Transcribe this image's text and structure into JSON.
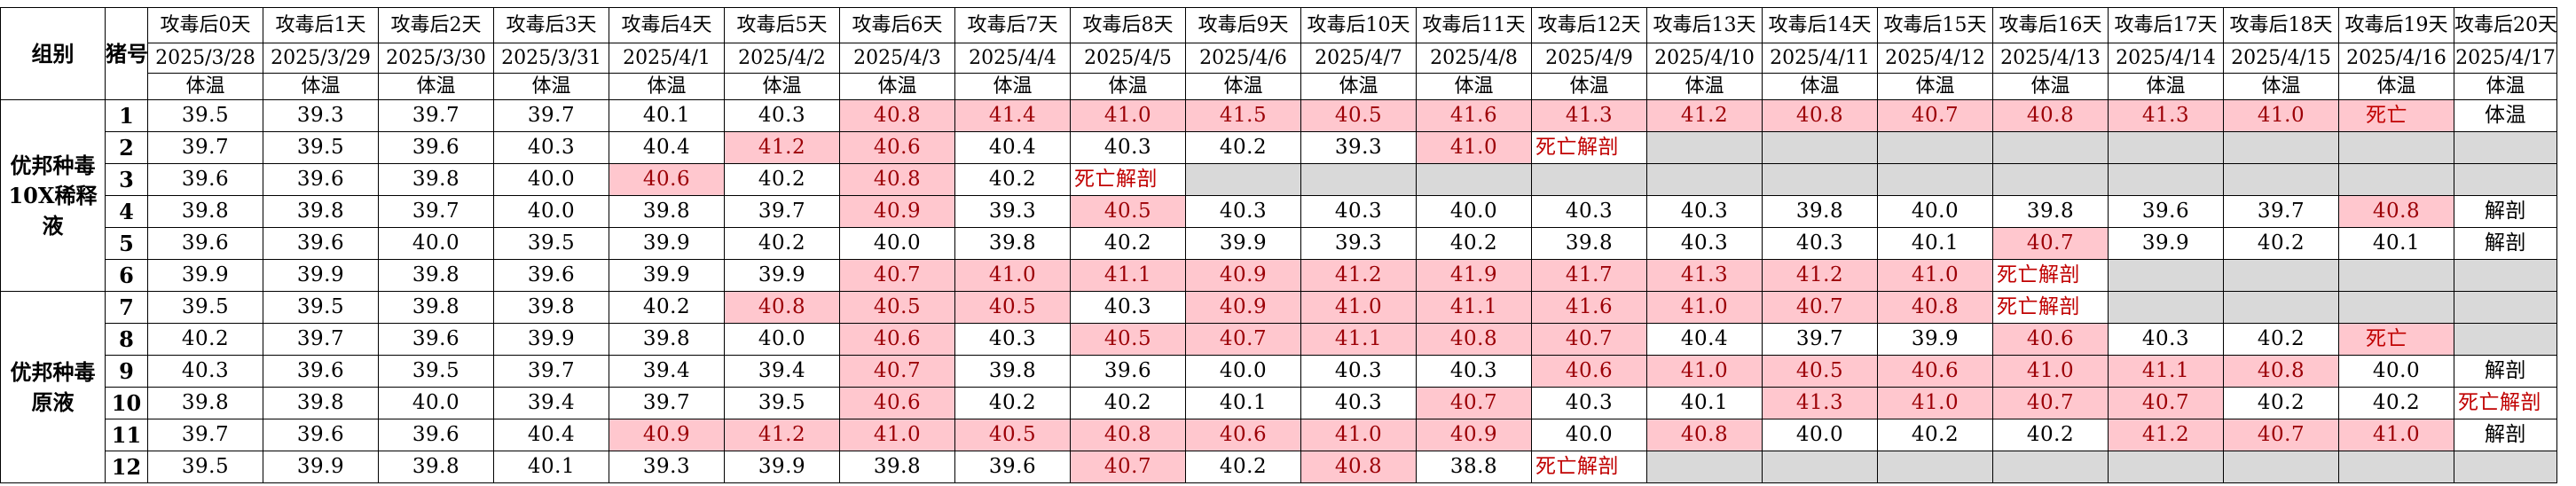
{
  "header": {
    "group_label": "组别",
    "pig_label": "猪号",
    "days": [
      "攻毒后0天",
      "攻毒后1天",
      "攻毒后2天",
      "攻毒后3天",
      "攻毒后4天",
      "攻毒后5天",
      "攻毒后6天",
      "攻毒后7天",
      "攻毒后8天",
      "攻毒后9天",
      "攻毒后10天",
      "攻毒后11天",
      "攻毒后12天",
      "攻毒后13天",
      "攻毒后14天",
      "攻毒后15天",
      "攻毒后16天",
      "攻毒后17天",
      "攻毒后18天",
      "攻毒后19天",
      "攻毒后20天"
    ],
    "dates": [
      "2025/3/28",
      "2025/3/29",
      "2025/3/30",
      "2025/3/31",
      "2025/4/1",
      "2025/4/2",
      "2025/4/3",
      "2025/4/4",
      "2025/4/5",
      "2025/4/6",
      "2025/4/7",
      "2025/4/8",
      "2025/4/9",
      "2025/4/10",
      "2025/4/11",
      "2025/4/12",
      "2025/4/13",
      "2025/4/14",
      "2025/4/15",
      "2025/4/16",
      "2025/4/17"
    ],
    "metric": "体温"
  },
  "groups": [
    {
      "name": "优邦种毒10X稀释液",
      "rows": [
        {
          "pig": "1",
          "cells": [
            {
              "v": "39.5"
            },
            {
              "v": "39.3"
            },
            {
              "v": "39.7"
            },
            {
              "v": "39.7"
            },
            {
              "v": "40.1"
            },
            {
              "v": "40.3"
            },
            {
              "v": "40.8",
              "s": "hot"
            },
            {
              "v": "41.4",
              "s": "hot"
            },
            {
              "v": "41.0",
              "s": "hot"
            },
            {
              "v": "41.5",
              "s": "hot"
            },
            {
              "v": "40.5",
              "s": "hot"
            },
            {
              "v": "41.6",
              "s": "hot"
            },
            {
              "v": "41.3",
              "s": "hot"
            },
            {
              "v": "41.2",
              "s": "hot"
            },
            {
              "v": "40.8",
              "s": "hot"
            },
            {
              "v": "40.7",
              "s": "hot"
            },
            {
              "v": "40.8",
              "s": "hot"
            },
            {
              "v": "41.3",
              "s": "hot"
            },
            {
              "v": "41.0",
              "s": "hot"
            },
            {
              "v": "死亡",
              "s": "hotdead"
            },
            {
              "v": "体温"
            }
          ]
        },
        {
          "pig": "2",
          "cells": [
            {
              "v": "39.7"
            },
            {
              "v": "39.5"
            },
            {
              "v": "39.6"
            },
            {
              "v": "40.3"
            },
            {
              "v": "40.4"
            },
            {
              "v": "41.2",
              "s": "hot"
            },
            {
              "v": "40.6",
              "s": "hot"
            },
            {
              "v": "40.4"
            },
            {
              "v": "40.3"
            },
            {
              "v": "40.2"
            },
            {
              "v": "39.3"
            },
            {
              "v": "41.0",
              "s": "hot"
            },
            {
              "v": "死亡解剖",
              "s": "dead"
            },
            {
              "v": "",
              "s": "gray"
            },
            {
              "v": "",
              "s": "gray"
            },
            {
              "v": "",
              "s": "gray"
            },
            {
              "v": "",
              "s": "gray"
            },
            {
              "v": "",
              "s": "gray"
            },
            {
              "v": "",
              "s": "gray"
            },
            {
              "v": "",
              "s": "gray"
            },
            {
              "v": "",
              "s": "gray"
            }
          ]
        },
        {
          "pig": "3",
          "cells": [
            {
              "v": "39.6"
            },
            {
              "v": "39.6"
            },
            {
              "v": "39.8"
            },
            {
              "v": "40.0"
            },
            {
              "v": "40.6",
              "s": "hot"
            },
            {
              "v": "40.2"
            },
            {
              "v": "40.8",
              "s": "hot"
            },
            {
              "v": "40.2"
            },
            {
              "v": "死亡解剖",
              "s": "dead"
            },
            {
              "v": "",
              "s": "gray"
            },
            {
              "v": "",
              "s": "gray"
            },
            {
              "v": "",
              "s": "gray"
            },
            {
              "v": "",
              "s": "gray"
            },
            {
              "v": "",
              "s": "gray"
            },
            {
              "v": "",
              "s": "gray"
            },
            {
              "v": "",
              "s": "gray"
            },
            {
              "v": "",
              "s": "gray"
            },
            {
              "v": "",
              "s": "gray"
            },
            {
              "v": "",
              "s": "gray"
            },
            {
              "v": "",
              "s": "gray"
            },
            {
              "v": "",
              "s": "gray"
            }
          ]
        },
        {
          "pig": "4",
          "cells": [
            {
              "v": "39.8"
            },
            {
              "v": "39.8"
            },
            {
              "v": "39.7"
            },
            {
              "v": "40.0"
            },
            {
              "v": "39.8"
            },
            {
              "v": "39.7"
            },
            {
              "v": "40.9",
              "s": "hot"
            },
            {
              "v": "39.3"
            },
            {
              "v": "40.5",
              "s": "hot"
            },
            {
              "v": "40.3"
            },
            {
              "v": "40.3"
            },
            {
              "v": "40.0"
            },
            {
              "v": "40.3"
            },
            {
              "v": "40.3"
            },
            {
              "v": "39.8"
            },
            {
              "v": "40.0"
            },
            {
              "v": "39.8"
            },
            {
              "v": "39.6"
            },
            {
              "v": "39.7"
            },
            {
              "v": "40.8",
              "s": "hot"
            },
            {
              "v": "解剖"
            }
          ]
        },
        {
          "pig": "5",
          "cells": [
            {
              "v": "39.6"
            },
            {
              "v": "39.6"
            },
            {
              "v": "40.0"
            },
            {
              "v": "39.5"
            },
            {
              "v": "39.9"
            },
            {
              "v": "40.2"
            },
            {
              "v": "40.0"
            },
            {
              "v": "39.8"
            },
            {
              "v": "40.2"
            },
            {
              "v": "39.9"
            },
            {
              "v": "39.3"
            },
            {
              "v": "40.2"
            },
            {
              "v": "39.8"
            },
            {
              "v": "40.3"
            },
            {
              "v": "40.3"
            },
            {
              "v": "40.1"
            },
            {
              "v": "40.7",
              "s": "hot"
            },
            {
              "v": "39.9"
            },
            {
              "v": "40.2"
            },
            {
              "v": "40.1"
            },
            {
              "v": "解剖"
            }
          ]
        },
        {
          "pig": "6",
          "cells": [
            {
              "v": "39.9"
            },
            {
              "v": "39.9"
            },
            {
              "v": "39.8"
            },
            {
              "v": "39.6"
            },
            {
              "v": "39.9"
            },
            {
              "v": "39.9"
            },
            {
              "v": "40.7",
              "s": "hot"
            },
            {
              "v": "41.0",
              "s": "hot"
            },
            {
              "v": "41.1",
              "s": "hot"
            },
            {
              "v": "40.9",
              "s": "hot"
            },
            {
              "v": "41.2",
              "s": "hot"
            },
            {
              "v": "41.9",
              "s": "hot"
            },
            {
              "v": "41.7",
              "s": "hot"
            },
            {
              "v": "41.3",
              "s": "hot"
            },
            {
              "v": "41.2",
              "s": "hot"
            },
            {
              "v": "41.0",
              "s": "hot"
            },
            {
              "v": "死亡解剖",
              "s": "dead"
            },
            {
              "v": "",
              "s": "gray"
            },
            {
              "v": "",
              "s": "gray"
            },
            {
              "v": "",
              "s": "gray"
            },
            {
              "v": "",
              "s": "gray"
            }
          ]
        }
      ]
    },
    {
      "name": "优邦种毒原液",
      "rows": [
        {
          "pig": "7",
          "cells": [
            {
              "v": "39.5"
            },
            {
              "v": "39.5"
            },
            {
              "v": "39.8"
            },
            {
              "v": "39.8"
            },
            {
              "v": "40.2"
            },
            {
              "v": "40.8",
              "s": "hot"
            },
            {
              "v": "40.5",
              "s": "hot"
            },
            {
              "v": "40.5",
              "s": "hot"
            },
            {
              "v": "40.3"
            },
            {
              "v": "40.9",
              "s": "hot"
            },
            {
              "v": "41.0",
              "s": "hot"
            },
            {
              "v": "41.1",
              "s": "hot"
            },
            {
              "v": "41.6",
              "s": "hot"
            },
            {
              "v": "41.0",
              "s": "hot"
            },
            {
              "v": "40.7",
              "s": "hot"
            },
            {
              "v": "40.8",
              "s": "hot"
            },
            {
              "v": "死亡解剖",
              "s": "dead"
            },
            {
              "v": "",
              "s": "gray"
            },
            {
              "v": "",
              "s": "gray"
            },
            {
              "v": "",
              "s": "gray"
            },
            {
              "v": "",
              "s": "gray"
            }
          ]
        },
        {
          "pig": "8",
          "cells": [
            {
              "v": "40.2"
            },
            {
              "v": "39.7"
            },
            {
              "v": "39.6"
            },
            {
              "v": "39.9"
            },
            {
              "v": "39.8"
            },
            {
              "v": "40.0"
            },
            {
              "v": "40.6",
              "s": "hot"
            },
            {
              "v": "40.3"
            },
            {
              "v": "40.5",
              "s": "hot"
            },
            {
              "v": "40.7",
              "s": "hot"
            },
            {
              "v": "41.1",
              "s": "hot"
            },
            {
              "v": "40.8",
              "s": "hot"
            },
            {
              "v": "40.7",
              "s": "hot"
            },
            {
              "v": "40.4"
            },
            {
              "v": "39.7"
            },
            {
              "v": "39.9"
            },
            {
              "v": "40.6",
              "s": "hot"
            },
            {
              "v": "40.3"
            },
            {
              "v": "40.2"
            },
            {
              "v": "死亡",
              "s": "hotdead"
            },
            {
              "v": "",
              "s": "gray"
            }
          ]
        },
        {
          "pig": "9",
          "cells": [
            {
              "v": "40.3"
            },
            {
              "v": "39.6"
            },
            {
              "v": "39.5"
            },
            {
              "v": "39.7"
            },
            {
              "v": "39.4"
            },
            {
              "v": "39.4"
            },
            {
              "v": "40.7",
              "s": "hot"
            },
            {
              "v": "39.8"
            },
            {
              "v": "39.6"
            },
            {
              "v": "40.0"
            },
            {
              "v": "40.3"
            },
            {
              "v": "40.3"
            },
            {
              "v": "40.6",
              "s": "hot"
            },
            {
              "v": "41.0",
              "s": "hot"
            },
            {
              "v": "40.5",
              "s": "hot"
            },
            {
              "v": "40.6",
              "s": "hot"
            },
            {
              "v": "41.0",
              "s": "hot"
            },
            {
              "v": "41.1",
              "s": "hot"
            },
            {
              "v": "40.8",
              "s": "hot"
            },
            {
              "v": "40.0"
            },
            {
              "v": "解剖"
            }
          ]
        },
        {
          "pig": "10",
          "cells": [
            {
              "v": "39.8"
            },
            {
              "v": "39.8"
            },
            {
              "v": "40.0"
            },
            {
              "v": "39.4"
            },
            {
              "v": "39.7"
            },
            {
              "v": "39.5"
            },
            {
              "v": "40.6",
              "s": "hot"
            },
            {
              "v": "40.2"
            },
            {
              "v": "40.2"
            },
            {
              "v": "40.1"
            },
            {
              "v": "40.3"
            },
            {
              "v": "40.7",
              "s": "hot"
            },
            {
              "v": "40.3"
            },
            {
              "v": "40.1"
            },
            {
              "v": "41.3",
              "s": "hot"
            },
            {
              "v": "41.0",
              "s": "hot"
            },
            {
              "v": "40.7",
              "s": "hot"
            },
            {
              "v": "40.7",
              "s": "hot"
            },
            {
              "v": "40.2"
            },
            {
              "v": "40.2"
            },
            {
              "v": "死亡解剖",
              "s": "dead"
            }
          ]
        },
        {
          "pig": "11",
          "cells": [
            {
              "v": "39.7"
            },
            {
              "v": "39.6"
            },
            {
              "v": "39.6"
            },
            {
              "v": "40.4"
            },
            {
              "v": "40.9",
              "s": "hot"
            },
            {
              "v": "41.2",
              "s": "hot"
            },
            {
              "v": "41.0",
              "s": "hot"
            },
            {
              "v": "40.5",
              "s": "hot"
            },
            {
              "v": "40.8",
              "s": "hot"
            },
            {
              "v": "40.6",
              "s": "hot"
            },
            {
              "v": "41.0",
              "s": "hot"
            },
            {
              "v": "40.9",
              "s": "hot"
            },
            {
              "v": "40.0"
            },
            {
              "v": "40.8",
              "s": "hot"
            },
            {
              "v": "40.0"
            },
            {
              "v": "40.2"
            },
            {
              "v": "40.2"
            },
            {
              "v": "41.2",
              "s": "hot"
            },
            {
              "v": "40.7",
              "s": "hot"
            },
            {
              "v": "41.0",
              "s": "hot"
            },
            {
              "v": "解剖"
            }
          ]
        },
        {
          "pig": "12",
          "cells": [
            {
              "v": "39.5"
            },
            {
              "v": "39.9"
            },
            {
              "v": "39.8"
            },
            {
              "v": "40.1"
            },
            {
              "v": "39.3"
            },
            {
              "v": "39.9"
            },
            {
              "v": "39.8"
            },
            {
              "v": "39.6"
            },
            {
              "v": "40.7",
              "s": "hot"
            },
            {
              "v": "40.2"
            },
            {
              "v": "40.8",
              "s": "hot"
            },
            {
              "v": "38.8"
            },
            {
              "v": "死亡解剖",
              "s": "dead"
            },
            {
              "v": "",
              "s": "gray"
            },
            {
              "v": "",
              "s": "gray"
            },
            {
              "v": "",
              "s": "gray"
            },
            {
              "v": "",
              "s": "gray"
            },
            {
              "v": "",
              "s": "gray"
            },
            {
              "v": "",
              "s": "gray"
            },
            {
              "v": "",
              "s": "gray"
            },
            {
              "v": "",
              "s": "gray"
            }
          ]
        }
      ]
    }
  ],
  "colors": {
    "fever_fill": "#ffc7ce",
    "fever_text": "#9c0006",
    "death_text": "#c00000",
    "after_death_fill": "#d9d9d9"
  }
}
